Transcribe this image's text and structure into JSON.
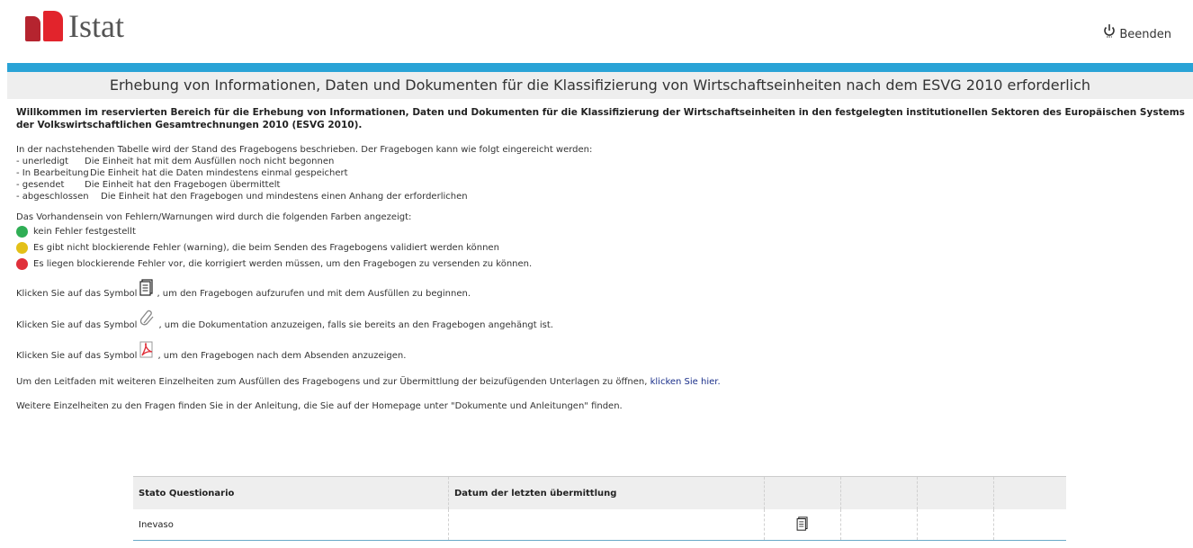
{
  "header": {
    "logo_text": "Istat",
    "logout_label": "Beenden"
  },
  "title": "Erhebung von Informationen, Daten und Dokumenten für die Klassifizierung von Wirtschaftseinheiten nach dem ESVG 2010 erforderlich",
  "welcome": "Willkommen im reservierten Bereich für die Erhebung von Informationen, Daten und Dokumenten für die Klassifizierung der Wirtschaftseinheiten in den festgelegten institutionellen Sektoren des Europäischen Systems der Volkswirtschaftlichen Gesamtrechnungen 2010 (ESVG 2010).",
  "states": {
    "intro": "In der nachstehenden Tabelle wird der Stand des Fragebogens beschrieben. Der Fragebogen kann wie folgt eingereicht werden:",
    "items": [
      {
        "key": "- unerledigt",
        "desc": "Die Einheit hat mit dem Ausfüllen noch nicht begonnen"
      },
      {
        "key": "- In Bearbeitung",
        "desc": "Die Einheit hat die Daten mindestens einmal gespeichert"
      },
      {
        "key": "- gesendet",
        "desc": "Die Einheit hat den Fragebogen übermittelt"
      },
      {
        "key": "- abgeschlossen",
        "desc": "Die Einheit hat den Fragebogen und mindestens einen Anhang der erforderlichen"
      }
    ]
  },
  "colors": {
    "intro": "Das Vorhandensein von Fehlern/Warnungen wird durch die folgenden Farben angezeigt:",
    "green": "kein Fehler festgestellt",
    "yellow": "Es gibt nicht blockierende Fehler (warning), die beim Senden des Fragebogens validiert werden können",
    "red": "Es liegen blockierende Fehler vor, die korrigiert werden müssen, um den Fragebogen zu versenden zu können."
  },
  "symbols": {
    "prefix": "Klicken Sie auf das Symbol",
    "questionnaire": ", um den Fragebogen aufzurufen und mit dem Ausfüllen zu beginnen.",
    "attachment": ", um die Dokumentation anzuzeigen, falls sie bereits an den Fragebogen angehängt ist.",
    "pdf": ", um den Fragebogen nach dem Absenden anzuzeigen."
  },
  "guide": {
    "text": "Um den Leitfaden mit weiteren Einzelheiten zum Ausfüllen des Fragebogens und zur Übermittlung der beizufügenden Unterlagen zu öffnen,",
    "link": "klicken Sie hier."
  },
  "more_info": "Weitere Einzelheiten zu den Fragen finden Sie in der Anleitung, die Sie auf der Homepage unter \"Dokumente und Anleitungen\" finden.",
  "table": {
    "headers": [
      "Stato Questionario",
      "Datum der letzten übermittlung",
      "",
      "",
      "",
      ""
    ],
    "rows": [
      {
        "status": "Inevaso",
        "date": ""
      }
    ]
  },
  "icons": {
    "logout": "power-icon",
    "questionnaire": "document-icon",
    "attachment": "paperclip-icon",
    "pdf": "pdf-icon"
  },
  "accent_colors": {
    "header_bar": "#29a3d6",
    "green": "#2fae55",
    "yellow": "#e3c018",
    "red": "#e0303a"
  }
}
